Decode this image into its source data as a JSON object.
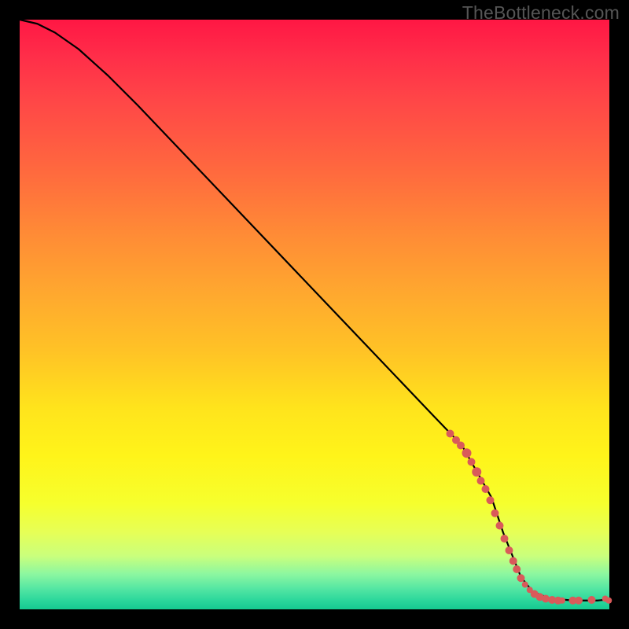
{
  "watermark": "TheBottleneck.com",
  "colors": {
    "background": "#000000",
    "curve": "#000000",
    "marker": "#d95a5a",
    "gradient_top": "#ff1744",
    "gradient_mid": "#ffe41c",
    "gradient_bottom": "#16c98f"
  },
  "chart_data": {
    "type": "line",
    "title": "",
    "xlabel": "",
    "ylabel": "",
    "xlim": [
      0,
      100
    ],
    "ylim": [
      0,
      100
    ],
    "grid": false,
    "legend": false,
    "series": [
      {
        "name": "curve",
        "x": [
          0,
          3,
          6,
          10,
          15,
          20,
          30,
          40,
          50,
          60,
          70,
          75,
          80,
          82,
          84,
          85,
          87,
          90,
          94,
          98,
          100
        ],
        "y": [
          100,
          99.3,
          97.8,
          95,
          90.5,
          85.5,
          75,
          64.5,
          54,
          43.5,
          33,
          27.8,
          19,
          13,
          8,
          5.5,
          3,
          1.8,
          1.5,
          1.5,
          1.7
        ]
      }
    ],
    "markers": [
      {
        "x": 73.0,
        "y": 29.8,
        "r": 5
      },
      {
        "x": 74.0,
        "y": 28.7,
        "r": 5
      },
      {
        "x": 74.8,
        "y": 27.8,
        "r": 5
      },
      {
        "x": 75.8,
        "y": 26.5,
        "r": 6
      },
      {
        "x": 76.6,
        "y": 25.0,
        "r": 5
      },
      {
        "x": 77.5,
        "y": 23.3,
        "r": 6
      },
      {
        "x": 78.2,
        "y": 21.8,
        "r": 5
      },
      {
        "x": 79.0,
        "y": 20.4,
        "r": 5
      },
      {
        "x": 79.8,
        "y": 18.5,
        "r": 5
      },
      {
        "x": 80.6,
        "y": 16.3,
        "r": 5
      },
      {
        "x": 81.4,
        "y": 14.2,
        "r": 5
      },
      {
        "x": 82.2,
        "y": 12.0,
        "r": 5
      },
      {
        "x": 83.0,
        "y": 10.0,
        "r": 5
      },
      {
        "x": 83.7,
        "y": 8.2,
        "r": 5
      },
      {
        "x": 84.3,
        "y": 6.8,
        "r": 5
      },
      {
        "x": 85.0,
        "y": 5.3,
        "r": 5
      },
      {
        "x": 85.7,
        "y": 4.2,
        "r": 4
      },
      {
        "x": 86.5,
        "y": 3.3,
        "r": 4
      },
      {
        "x": 87.3,
        "y": 2.6,
        "r": 5
      },
      {
        "x": 88.2,
        "y": 2.1,
        "r": 5
      },
      {
        "x": 89.2,
        "y": 1.8,
        "r": 5
      },
      {
        "x": 90.3,
        "y": 1.6,
        "r": 5
      },
      {
        "x": 91.3,
        "y": 1.5,
        "r": 5
      },
      {
        "x": 92.0,
        "y": 1.5,
        "r": 4
      },
      {
        "x": 93.8,
        "y": 1.5,
        "r": 5
      },
      {
        "x": 94.8,
        "y": 1.5,
        "r": 5
      },
      {
        "x": 97.0,
        "y": 1.6,
        "r": 5
      },
      {
        "x": 99.3,
        "y": 1.8,
        "r": 4
      },
      {
        "x": 99.9,
        "y": 1.5,
        "r": 4
      }
    ]
  }
}
